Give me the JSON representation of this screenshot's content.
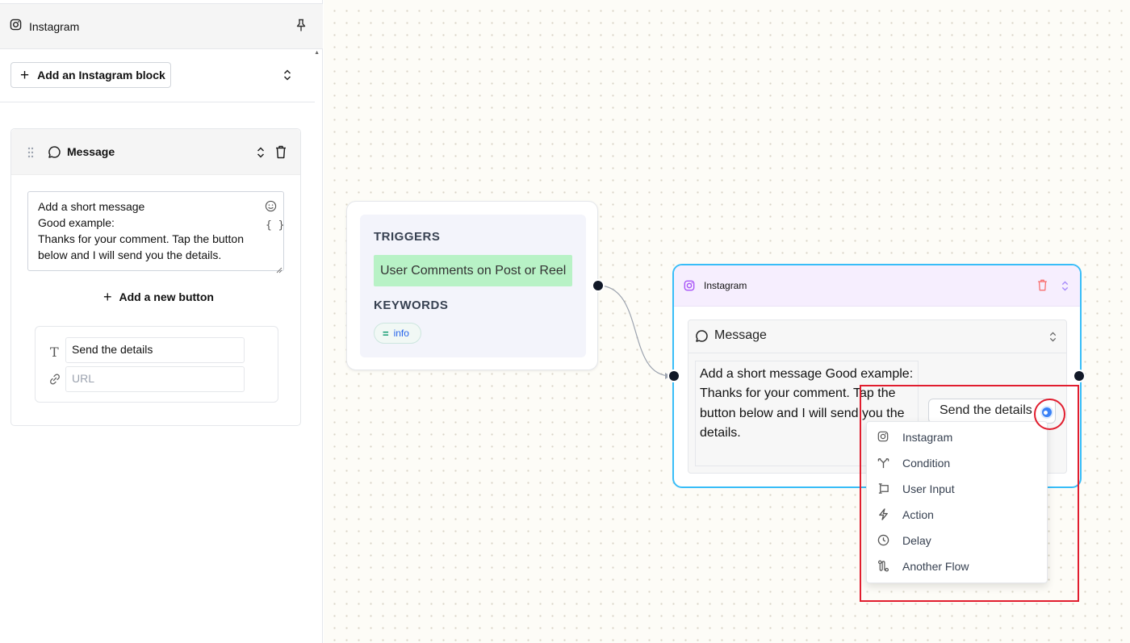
{
  "sidebar": {
    "title": "Instagram",
    "add_block_label": "Add an Instagram block",
    "message_card": {
      "label": "Message",
      "text": "Add a short message\nGood example:\nThanks for your comment. Tap the button below and I will send you the details.",
      "braces": "{ }",
      "add_button_label": "Add a new button",
      "button_text_value": "Send the details",
      "url_placeholder": "URL"
    }
  },
  "canvas": {
    "trigger_node": {
      "triggers_title": "TRIGGERS",
      "trigger": "User Comments on Post or Reel",
      "keywords_title": "KEYWORDS",
      "keyword": "info"
    },
    "instagram_node": {
      "title": "Instagram",
      "message_label": "Message",
      "message_text": "Add a short message\nGood example:\nThanks for your comment. Tap the button below and I will send you the details.",
      "button_label": "Send the details"
    },
    "dropdown": {
      "items": [
        {
          "label": "Instagram",
          "icon": "instagram-icon"
        },
        {
          "label": "Condition",
          "icon": "condition-icon"
        },
        {
          "label": "User Input",
          "icon": "user-input-icon"
        },
        {
          "label": "Action",
          "icon": "lightning-icon"
        },
        {
          "label": "Delay",
          "icon": "clock-icon"
        },
        {
          "label": "Another Flow",
          "icon": "flow-icon"
        }
      ]
    }
  },
  "colors": {
    "trigger_chip": "#b8f2c6",
    "node_border": "#38bdf8",
    "node_header": "#f6eefe",
    "highlight": "#e11d2e",
    "button_dot": "#3b82f6"
  }
}
